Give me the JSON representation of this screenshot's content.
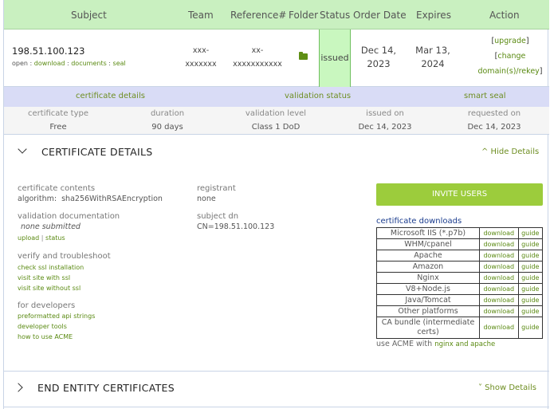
{
  "header": {
    "subject": "Subject",
    "team": "Team",
    "reference": "Reference#",
    "folder": "Folder",
    "status": "Status",
    "order_date": "Order Date",
    "expires": "Expires",
    "action": "Action"
  },
  "cert": {
    "subject": "198.51.100.123",
    "open": "open",
    "download": "download",
    "documents": "documents",
    "seal": "seal",
    "team_line1": "xxx-",
    "team_line2": "xxxxxxx",
    "ref_line1": "xx-",
    "ref_line2": "xxxxxxxxxxx",
    "status": "issued",
    "order_line1": "Dec 14,",
    "order_line2": "2023",
    "expires_line1": "Mar 13,",
    "expires_line2": "2024",
    "action_upgrade": "upgrade",
    "action_change": "change",
    "action_domains": "domain(s)/rekey"
  },
  "subtabs": {
    "details": "certificate details",
    "validation": "validation status",
    "seal": "smart seal"
  },
  "info": {
    "headers": [
      "certificate type",
      "duration",
      "validation level",
      "issued on",
      "requested on"
    ],
    "values": [
      "Free",
      "90 days",
      "Class 1 DoD",
      "Dec 14, 2023",
      "Dec 14, 2023"
    ]
  },
  "details_section": {
    "title": "CERTIFICATE DETAILS",
    "toggle": "^ Hide Details"
  },
  "details": {
    "contents_label": "certificate contents",
    "algorithm_label": "algorithm:",
    "algorithm_value": "sha256WithRSAEncryption",
    "registrant_label": "registrant",
    "registrant_value": "none",
    "valdoc_label": "validation documentation",
    "valdoc_value": "none submitted",
    "upload": "upload",
    "status": "status",
    "subjectdn_label": "subject dn",
    "subjectdn_value": "CN=198.51.100.123",
    "verify_label": "verify and troubleshoot",
    "verify_links": [
      "check ssl installation",
      "visit site with ssl",
      "visit site without ssl"
    ],
    "dev_label": "for developers",
    "dev_links": [
      "preformatted api strings",
      "developer tools",
      "how to use ACME"
    ]
  },
  "invite_button": "INVITE USERS",
  "downloads": {
    "title": "certificate downloads",
    "download_label": "download",
    "guide_label": "guide",
    "platforms": [
      "Microsoft IIS (*.p7b)",
      "WHM/cpanel",
      "Apache",
      "Amazon",
      "Nginx",
      "V8+Node.js",
      "Java/Tomcat",
      "Other platforms",
      "CA bundle (intermediate certs)"
    ],
    "acme_prefix": "use ACME with",
    "acme_links": "nginx and apache"
  },
  "end_entity_section": {
    "title": "END ENTITY CERTIFICATES",
    "toggle": "˅ Show Details"
  },
  "colors": {
    "header_bg": "#c9f0c0",
    "status_bg": "#c9f7bf",
    "tabs_bg": "#d9dcf6",
    "link": "#5a8a12",
    "button": "#9ccc3c"
  }
}
